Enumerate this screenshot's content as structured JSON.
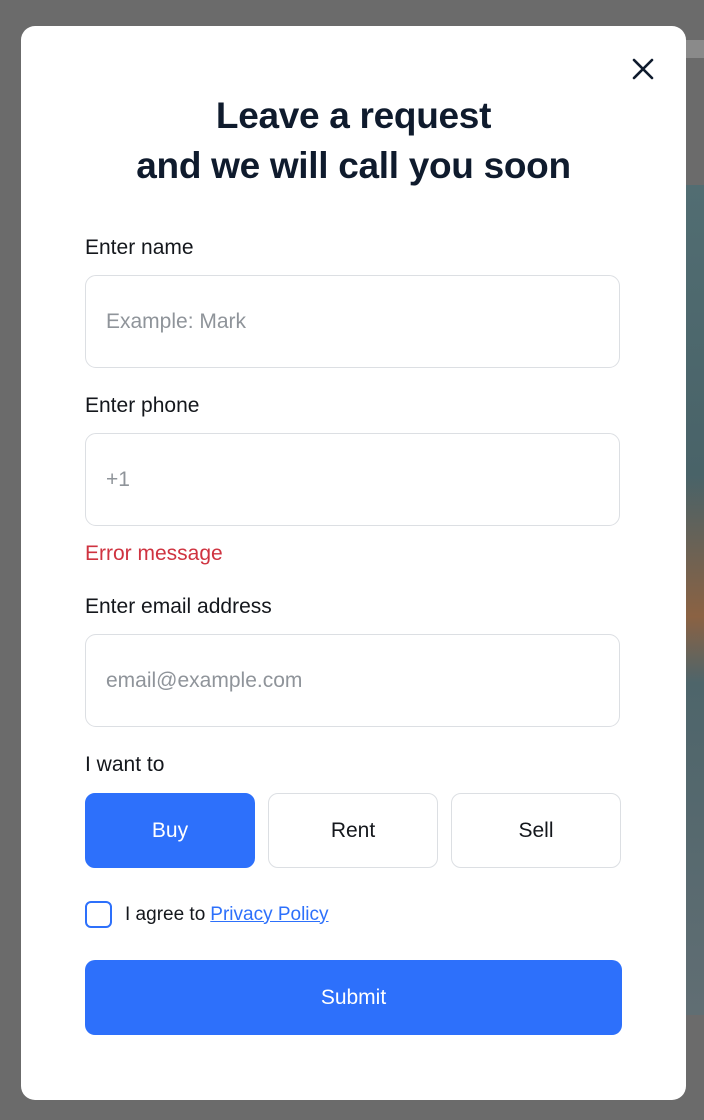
{
  "modal": {
    "title_line1": "Leave a request",
    "title_line2": "and we will call you soon",
    "close_icon": "close-icon"
  },
  "form": {
    "name": {
      "label": "Enter name",
      "value": "",
      "placeholder": "Example: Mark"
    },
    "phone": {
      "label": "Enter phone",
      "value": "",
      "placeholder": "+1",
      "error": "Error message"
    },
    "email": {
      "label": "Enter email address",
      "value": "",
      "placeholder": "email@example.com"
    },
    "intent": {
      "label": "I want to",
      "options": [
        "Buy",
        "Rent",
        "Sell"
      ],
      "selected": "Buy"
    },
    "agree": {
      "text": "I agree to",
      "link": "Privacy Policy",
      "checked": false
    },
    "submit_label": "Submit"
  },
  "colors": {
    "accent": "#2d70fb",
    "error": "#cf3340",
    "title": "#0f1b2d",
    "overlay": "#6b6b6b"
  }
}
